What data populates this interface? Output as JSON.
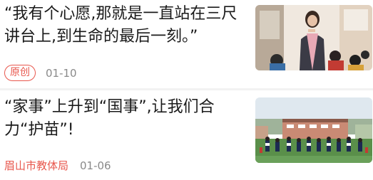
{
  "feed": {
    "items": [
      {
        "headline": "“我有个心愿,那就是一直站在三尺讲台上,到生命的最后一刻。”",
        "badge": "原创",
        "source": "",
        "date": "01-10",
        "thumbnail_icon": "teacher-classroom-photo"
      },
      {
        "headline": "“家事”上升到“国事”,让我们合力“护苗”!",
        "badge": "",
        "source": "眉山市教体局",
        "date": "01-06",
        "thumbnail_icon": "school-playground-photo"
      }
    ]
  },
  "colors": {
    "accent": "#e8574d",
    "meta_gray": "#8a8a8a",
    "divider": "#f2f2f2"
  }
}
